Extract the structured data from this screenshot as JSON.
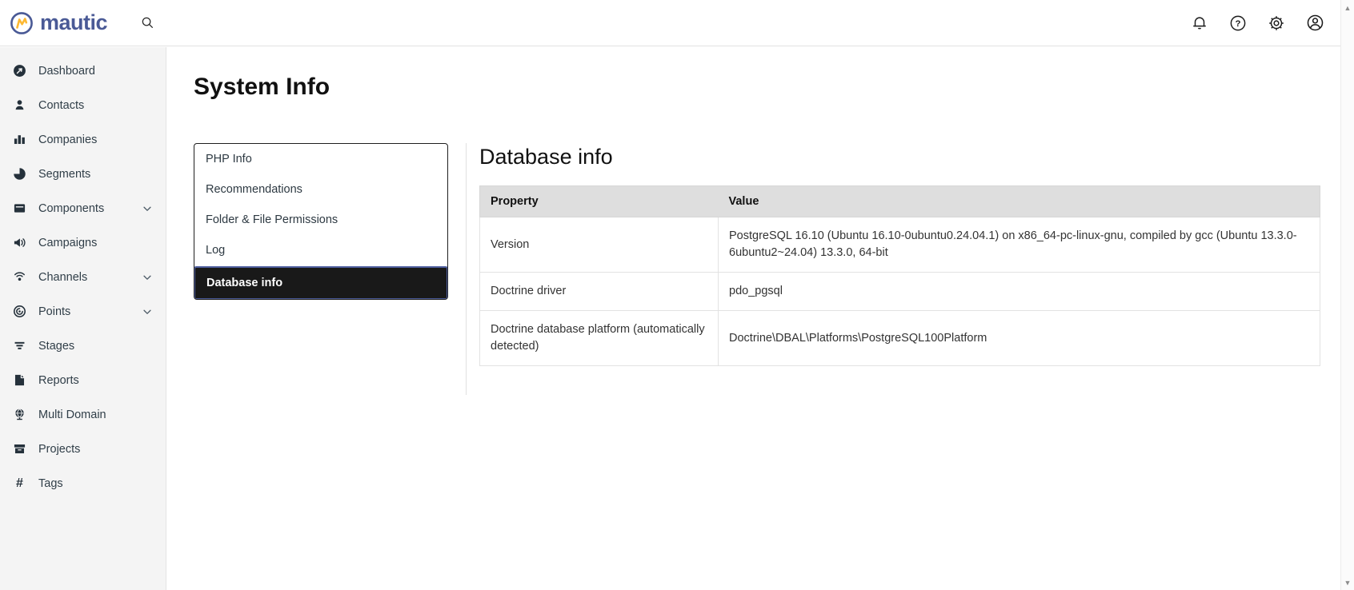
{
  "brand": {
    "name": "mautic"
  },
  "topbar": {
    "icons": [
      "bell-icon",
      "help-icon",
      "gear-icon",
      "account-icon"
    ]
  },
  "sidebar": {
    "items": [
      {
        "id": "dashboard",
        "label": "Dashboard",
        "icon": "dashboard-icon",
        "expandable": false
      },
      {
        "id": "contacts",
        "label": "Contacts",
        "icon": "contacts-icon",
        "expandable": false
      },
      {
        "id": "companies",
        "label": "Companies",
        "icon": "companies-icon",
        "expandable": false
      },
      {
        "id": "segments",
        "label": "Segments",
        "icon": "segments-icon",
        "expandable": false
      },
      {
        "id": "components",
        "label": "Components",
        "icon": "components-icon",
        "expandable": true
      },
      {
        "id": "campaigns",
        "label": "Campaigns",
        "icon": "campaigns-icon",
        "expandable": false
      },
      {
        "id": "channels",
        "label": "Channels",
        "icon": "channels-icon",
        "expandable": true
      },
      {
        "id": "points",
        "label": "Points",
        "icon": "points-icon",
        "expandable": true
      },
      {
        "id": "stages",
        "label": "Stages",
        "icon": "stages-icon",
        "expandable": false
      },
      {
        "id": "reports",
        "label": "Reports",
        "icon": "reports-icon",
        "expandable": false
      },
      {
        "id": "multi-domain",
        "label": "Multi Domain",
        "icon": "multi-domain-icon",
        "expandable": false
      },
      {
        "id": "projects",
        "label": "Projects",
        "icon": "projects-icon",
        "expandable": false
      },
      {
        "id": "tags",
        "label": "Tags",
        "icon": "tags-icon",
        "expandable": false
      }
    ]
  },
  "page": {
    "title": "System Info"
  },
  "tabs": {
    "items": [
      {
        "id": "php-info",
        "label": "PHP Info",
        "selected": false
      },
      {
        "id": "recommendations",
        "label": "Recommendations",
        "selected": false
      },
      {
        "id": "permissions",
        "label": "Folder & File Permissions",
        "selected": false
      },
      {
        "id": "log",
        "label": "Log",
        "selected": false
      },
      {
        "id": "database-info",
        "label": "Database info",
        "selected": true
      }
    ]
  },
  "panel": {
    "heading": "Database info",
    "table": {
      "columns": [
        "Property",
        "Value"
      ],
      "rows": [
        {
          "property": "Version",
          "value": "PostgreSQL 16.10 (Ubuntu 16.10-0ubuntu0.24.04.1) on x86_64-pc-linux-gnu, compiled by gcc (Ubuntu 13.3.0-6ubuntu2~24.04) 13.3.0, 64-bit"
        },
        {
          "property": "Doctrine driver",
          "value": "pdo_pgsql"
        },
        {
          "property": "Doctrine database platform (automatically detected)",
          "value": "Doctrine\\DBAL\\Platforms\\PostgreSQL100Platform"
        }
      ]
    }
  },
  "colors": {
    "brand_indigo": "#4a5a96",
    "brand_yellow": "#fdb933",
    "selected_tab_bg": "#191919",
    "selected_tab_border": "#4e5e9e",
    "sidebar_bg": "#f4f4f4",
    "table_header_bg": "#dedede"
  }
}
